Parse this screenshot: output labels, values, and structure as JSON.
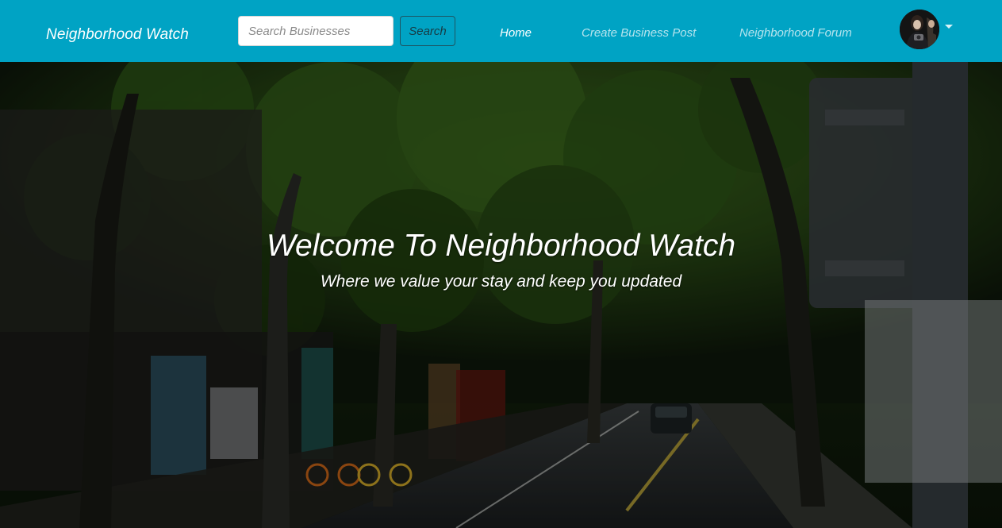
{
  "navbar": {
    "brand": "Neighborhood Watch",
    "search": {
      "placeholder": "Search Businesses",
      "value": "",
      "button_label": "Search"
    },
    "links": {
      "home": "Home",
      "create_business_post": "Create Business Post",
      "neighborhood_forum": "Neighborhood Forum"
    },
    "active_link": "Home",
    "user_menu": {
      "avatar_icon": "user-avatar-photo",
      "dropdown_icon": "caret-down-icon"
    }
  },
  "hero": {
    "title": "Welcome To Neighborhood Watch",
    "subtitle": "Where we value your stay and keep you updated",
    "background": "tree-lined street photo"
  },
  "colors": {
    "navbar_bg": "#00a3c4",
    "nav_active": "#ffffff",
    "nav_inactive": "#b6e4ee",
    "hero_text": "#ffffff"
  }
}
